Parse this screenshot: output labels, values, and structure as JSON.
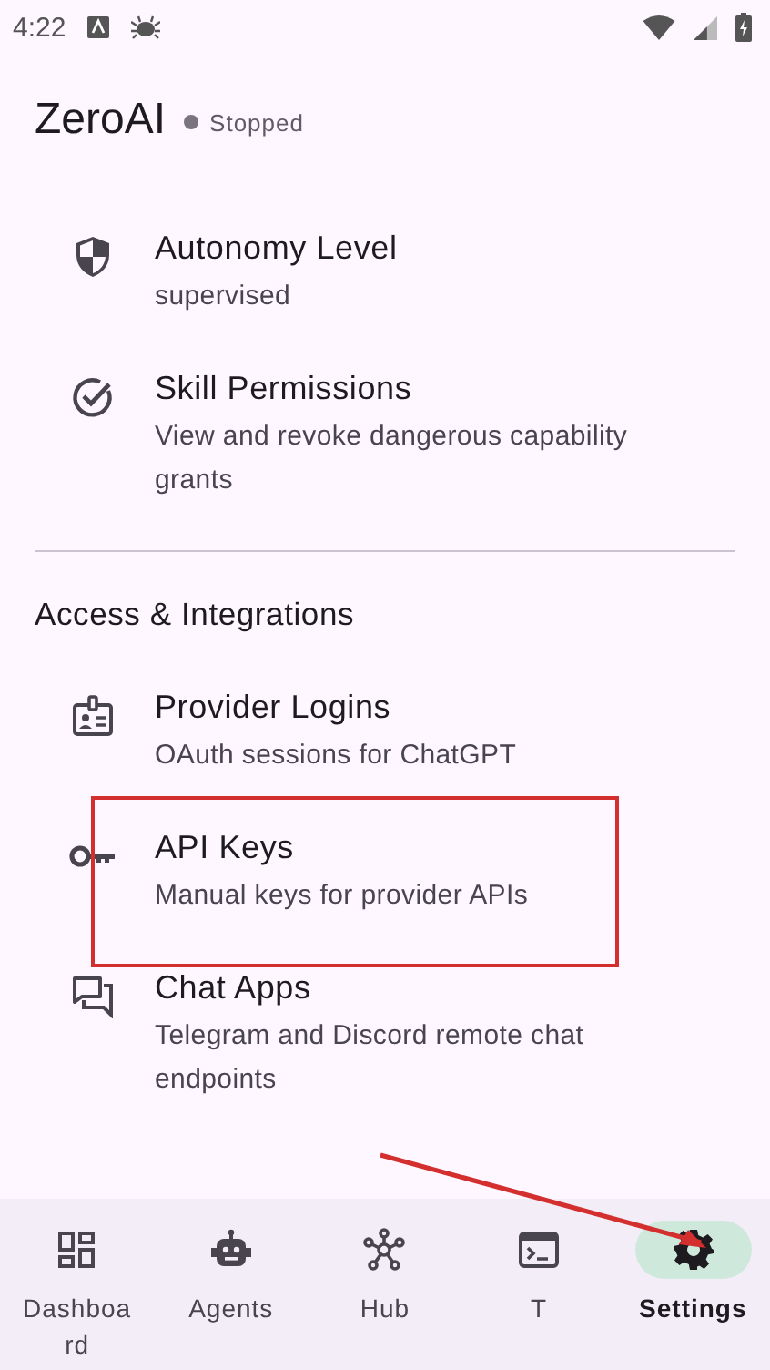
{
  "status_bar": {
    "time": "4:22"
  },
  "header": {
    "title": "ZeroAI",
    "status": "Stopped",
    "running": false
  },
  "sections": [
    {
      "items": [
        {
          "kind": "shield",
          "title": "Autonomy Level",
          "subtitle": "supervised",
          "highlighted": false
        },
        {
          "kind": "check",
          "title": "Skill Permissions",
          "subtitle": "View and revoke dangerous capability grants",
          "highlighted": false
        }
      ]
    },
    {
      "title": "Access & Integrations",
      "items": [
        {
          "kind": "badge",
          "title": "Provider Logins",
          "subtitle": "OAuth sessions for ChatGPT",
          "highlighted": false
        },
        {
          "kind": "key",
          "title": "API Keys",
          "subtitle": "Manual keys for provider APIs",
          "highlighted": true
        },
        {
          "kind": "chat",
          "title": "Chat Apps",
          "subtitle": "Telegram and Discord remote chat endpoints",
          "highlighted": false
        }
      ]
    }
  ],
  "nav": [
    {
      "kind": "dashboard",
      "label": "Dashboard",
      "selected": false
    },
    {
      "kind": "robot",
      "label": "Agents",
      "selected": false
    },
    {
      "kind": "hub",
      "label": "Hub",
      "selected": false
    },
    {
      "kind": "terminal",
      "label": "T",
      "selected": false
    },
    {
      "kind": "gear",
      "label": "Settings",
      "selected": true
    }
  ]
}
